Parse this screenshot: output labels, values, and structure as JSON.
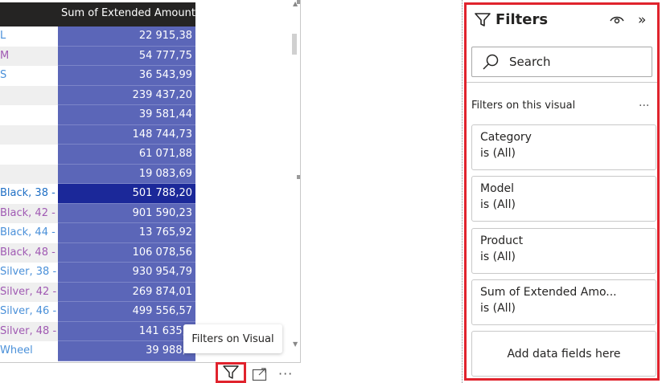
{
  "matrix": {
    "header": "Sum of Extended Amount",
    "rows": [
      {
        "label": "L",
        "value": "22 915,38",
        "color": "#4a90d9",
        "grey": false,
        "hl": false
      },
      {
        "label": "M",
        "value": "54 777,75",
        "color": "#a05ab3",
        "grey": true,
        "hl": false
      },
      {
        "label": "S",
        "value": "36 543,99",
        "color": "#4a90d9",
        "grey": false,
        "hl": false
      },
      {
        "label": "",
        "value": "239 437,20",
        "color": "#252423",
        "grey": true,
        "hl": false
      },
      {
        "label": "",
        "value": "39 581,44",
        "color": "#252423",
        "grey": false,
        "hl": false
      },
      {
        "label": "",
        "value": "148 744,73",
        "color": "#252423",
        "grey": true,
        "hl": false
      },
      {
        "label": "",
        "value": "61 071,88",
        "color": "#252423",
        "grey": false,
        "hl": false
      },
      {
        "label": "",
        "value": "19 083,69",
        "color": "#252423",
        "grey": true,
        "hl": false
      },
      {
        "label": "- Black, 38",
        "value": "501 788,20",
        "color": "#1f6fc5",
        "grey": false,
        "hl": true
      },
      {
        "label": "- Black, 42",
        "value": "901 590,23",
        "color": "#a05ab3",
        "grey": true,
        "hl": false
      },
      {
        "label": "- Black, 44",
        "value": "13 765,92",
        "color": "#4a90d9",
        "grey": false,
        "hl": false
      },
      {
        "label": "- Black, 48",
        "value": "106 078,56",
        "color": "#a05ab3",
        "grey": true,
        "hl": false
      },
      {
        "label": "- Silver, 38",
        "value": "930 954,79",
        "color": "#4a90d9",
        "grey": false,
        "hl": false
      },
      {
        "label": "- Silver, 42",
        "value": "269 874,01",
        "color": "#a05ab3",
        "grey": true,
        "hl": false
      },
      {
        "label": "- Silver, 46",
        "value": "499 556,57",
        "color": "#4a90d9",
        "grey": false,
        "hl": false
      },
      {
        "label": "- Silver, 48",
        "value": "141 635,1",
        "color": "#a05ab3",
        "grey": true,
        "hl": false
      },
      {
        "label": "Wheel",
        "value": "39 988,6",
        "color": "#4a90d9",
        "grey": false,
        "hl": false
      }
    ]
  },
  "visual_header": {
    "tooltip": "Filters on Visual",
    "more_label": "···",
    "filter_icon": "funnel-icon",
    "focus_icon": "focus-mode-icon"
  },
  "filters_pane": {
    "title": "Filters",
    "collapse_label": "»",
    "search_placeholder": "Search",
    "section_label": "Filters on this visual",
    "section_more": "...",
    "cards": [
      {
        "name": "Category",
        "condition": "is (All)"
      },
      {
        "name": "Model",
        "condition": "is (All)"
      },
      {
        "name": "Product",
        "condition": "is (All)"
      },
      {
        "name": "Sum of Extended Amo...",
        "condition": "is (All)"
      }
    ],
    "add_fields": "Add data fields here",
    "accent": "#e0232d"
  }
}
